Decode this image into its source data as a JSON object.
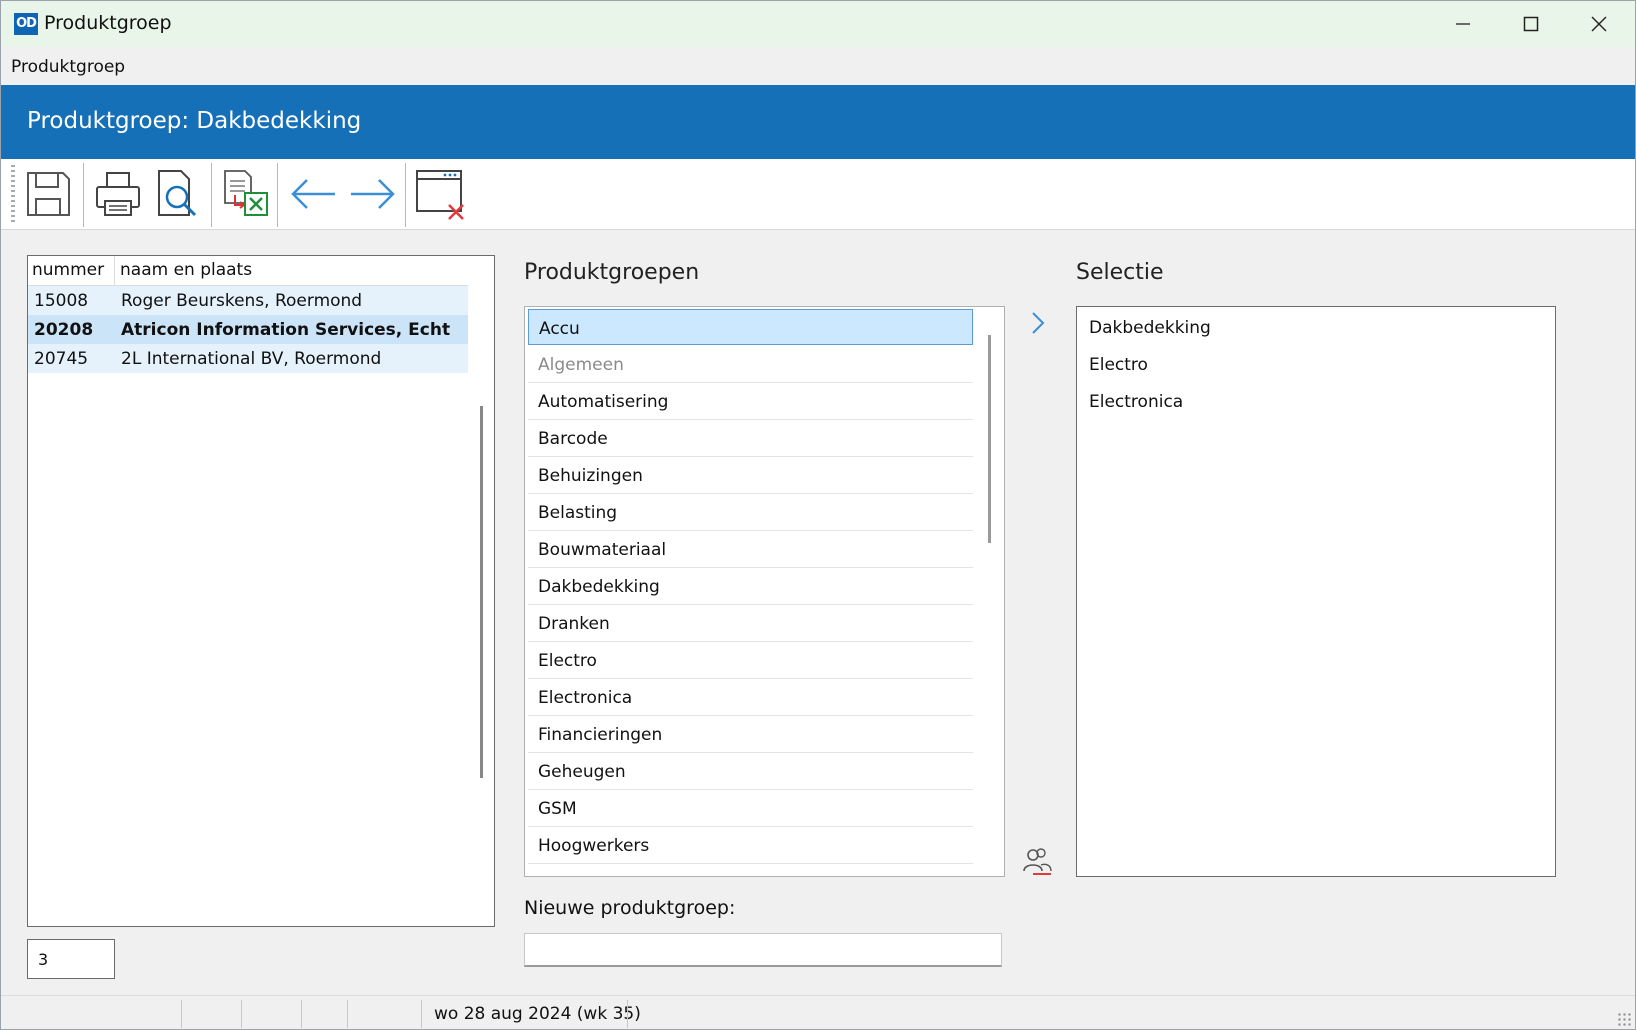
{
  "window": {
    "app_icon_text": "OD",
    "title": "Produktgroep"
  },
  "menu": {
    "items": [
      "Produktgroep"
    ]
  },
  "header": {
    "title": "Produktgroep: Dakbedekking",
    "bg_color": "#1670b8"
  },
  "toolbar": {
    "buttons": [
      "save-icon",
      "print-icon",
      "print-preview-icon",
      "export-excel-icon",
      "previous-arrow-icon",
      "next-arrow-icon",
      "close-window-icon"
    ]
  },
  "customers": {
    "columns": [
      "nummer",
      "naam en plaats"
    ],
    "rows": [
      {
        "nummer": "15008",
        "naam": "Roger Beurskens, Roermond"
      },
      {
        "nummer": "20208",
        "naam": "Atricon Information Services, Echt"
      },
      {
        "nummer": "20745",
        "naam": "2L International BV, Roermond"
      }
    ],
    "selected_index": 1,
    "count": "3"
  },
  "produktgroepen": {
    "label": "Produktgroepen",
    "items": [
      "Accu",
      "Algemeen",
      "Automatisering",
      "Barcode",
      "Behuizingen",
      "Belasting",
      "Bouwmateriaal",
      "Dakbedekking",
      "Dranken",
      "Electro",
      "Electronica",
      "Financieringen",
      "Geheugen",
      "GSM",
      "Hoogwerkers"
    ],
    "selected_index": 0,
    "disabled_index": 1
  },
  "selectie": {
    "label": "Selectie",
    "items": [
      "Dakbedekking",
      "Electro",
      "Electronica"
    ]
  },
  "new_group": {
    "label": "Nieuwe produktgroep:",
    "value": ""
  },
  "status": {
    "date": "wo 28 aug 2024 (wk 35)"
  }
}
